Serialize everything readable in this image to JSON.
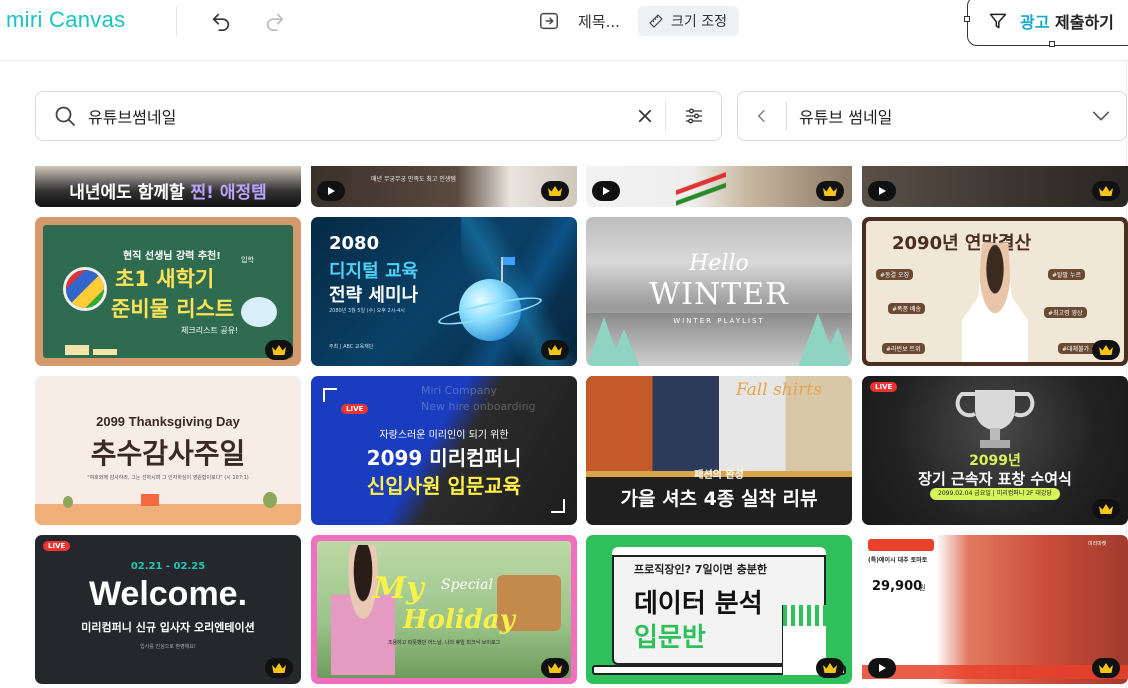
{
  "app": {
    "logo": "miri Canvas",
    "doc_title": "제목...",
    "resize_label": "크기 조정",
    "ad_label_highlight": "광고",
    "ad_label_rest": " 제출하기"
  },
  "search": {
    "value": "유튜브썸네일",
    "placeholder": ""
  },
  "category": {
    "selected": "유튜브 썸네일"
  },
  "colors": {
    "accent": "#16c5c0",
    "brand_highlight": "#1aa8c7"
  },
  "row0": [
    {
      "line1": "내년에도 함께할 ",
      "hl": "찐! 애정템",
      "play": false
    },
    {
      "line1": "매년 무궁무궁 만족도 최고 인생템",
      "play": true
    },
    {
      "line1": "",
      "play": true
    },
    {
      "line1": "",
      "play": true
    }
  ],
  "thumbs": [
    {
      "title1": "현직 선생님 강력 추천!",
      "title2": "초1 새학기",
      "title3": "준비물 리스트",
      "sub": "체크리스트 공유!",
      "tag": "입학"
    },
    {
      "title1": "2080",
      "title2": "디지털 교육",
      "title3": "전략 세미나",
      "sub": "2080년 3월 5일 (수) 오후 2시-4시",
      "sub2": "주최 | ABC 교육재단"
    },
    {
      "title1": "Hello",
      "title2": "WINTER",
      "sub": "WINTER PLAYLIST"
    },
    {
      "title1": "2090년 연말결산",
      "chips": [
        "#동결 오징",
        "#폭풍 배송",
        "#탈팔 누르",
        "#최고령 영상",
        "#라빈보 트위",
        "#대체불가 그림"
      ]
    },
    {
      "title1": "2099 Thanksgiving Day",
      "title2": "추수감사주일",
      "sub": "\"여호와께 감사하라, 그는 선하시며 그 인자하심이 영원함이로다\" (시 107:1)"
    },
    {
      "live": "LIVE",
      "title0": "Miri Company",
      "title0b": "New hire onboarding",
      "title1": "자랑스러운 미리인이 되기 위한",
      "title2": "2099 미리컴퍼니",
      "title3": "신입사원 입문교육"
    },
    {
      "title1": "Fall shirts",
      "title2": "패션의 완성",
      "title3": "가을 셔츠 4종 실착 리뷰"
    },
    {
      "live": "LIVE",
      "title1": "2099년",
      "title2": "장기 근속자 표창 수여식",
      "sub": "2099.02.04 금요일 | 미리컴퍼니 2F 대강당"
    },
    {
      "live": "LIVE",
      "title0": "02.21 - 02.25",
      "title1": "Welcome.",
      "title2": "미리컴퍼니 신규 입사자 오리엔테이션",
      "sub": "입사를 진심으로 환영해요!"
    },
    {
      "title1": "My",
      "title2": "Special",
      "title3": "Holiday",
      "sub": "조용하고 따뜻했던 어느날, 나의 휴일 피크닉 브이로그"
    },
    {
      "title1": "프로직장인? 7일이면 충분한",
      "title2": "데이터 분석",
      "title3": "입문반"
    },
    {
      "title1": "(특)에이시 대추 토마토",
      "title2": "29,900",
      "sub": "원",
      "tag": "미리마켓"
    }
  ]
}
